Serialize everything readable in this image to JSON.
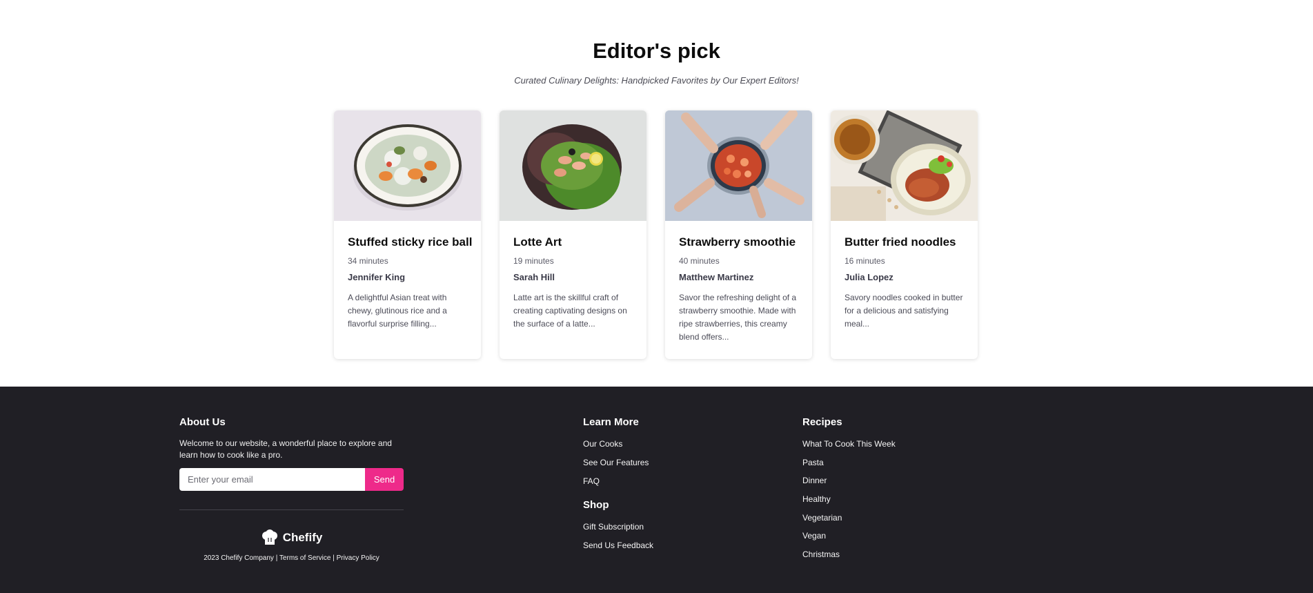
{
  "editors": {
    "title": "Editor's pick",
    "subtitle": "Curated Culinary Delights: Handpicked Favorites by Our Expert Editors!",
    "cards": [
      {
        "title": "Stuffed sticky rice ball",
        "time": "34 minutes",
        "author": "Jennifer King",
        "description": "A delightful Asian treat with chewy, glutinous rice and a flavorful surprise filling..."
      },
      {
        "title": "Lotte Art",
        "time": "19 minutes",
        "author": "Sarah Hill",
        "description": "Latte art is the skillful craft of creating captivating designs on the surface of a latte..."
      },
      {
        "title": "Strawberry smoothie",
        "time": "40 minutes",
        "author": "Matthew Martinez",
        "description": "Savor the refreshing delight of a strawberry smoothie. Made with ripe strawberries, this creamy blend offers..."
      },
      {
        "title": "Butter fried noodles",
        "time": "16 minutes",
        "author": "Julia Lopez",
        "description": "Savory noodles cooked in butter for a delicious and satisfying meal..."
      }
    ]
  },
  "footer": {
    "about": {
      "title": "About Us",
      "text": "Welcome to our website, a wonderful place to explore and learn how to cook like a pro.",
      "email_placeholder": "Enter your email",
      "send_label": "Send"
    },
    "brand": {
      "name": "Chefify",
      "icon": "chef-hat-icon"
    },
    "legal": {
      "copyright": "2023 Chefify Company",
      "separator": "|",
      "terms": "Terms of Service",
      "privacy": "Privacy Policy"
    },
    "learn_more": {
      "title": "Learn More",
      "links": [
        "Our Cooks",
        "See Our Features",
        "FAQ"
      ]
    },
    "shop": {
      "title": "Shop",
      "links": [
        "Gift Subscription",
        "Send Us Feedback"
      ]
    },
    "recipes": {
      "title": "Recipes",
      "links": [
        "What To Cook This Week",
        "Pasta",
        "Dinner",
        "Healthy",
        "Vegetarian",
        "Vegan",
        "Christmas"
      ]
    }
  },
  "colors": {
    "footer_bg": "#201f25",
    "accent": "#ee2a8a"
  }
}
